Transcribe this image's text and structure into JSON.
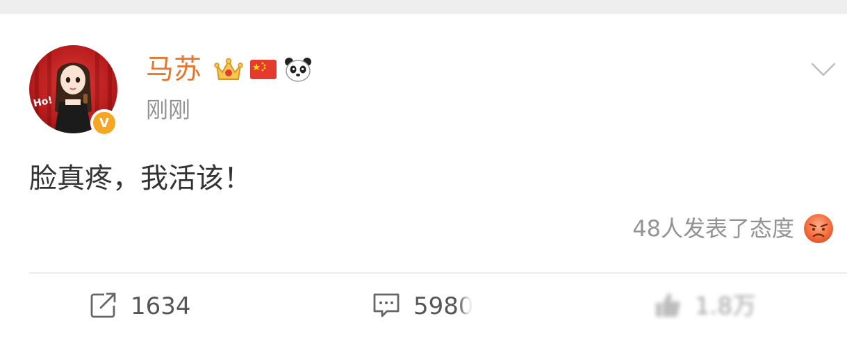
{
  "post": {
    "username": "马苏",
    "timestamp": "刚刚",
    "text": "脸真疼，我活该！",
    "reactions_text": "48人发表了态度",
    "user_badges": [
      "crown-icon",
      "china-flag-icon",
      "panda-icon"
    ],
    "verified_badge": "V",
    "avatar_text": "Ho!",
    "colors": {
      "username": "#e8772e",
      "muted": "#939393",
      "verified": "#f5a623"
    }
  },
  "actions": {
    "repost_count": "1634",
    "comment_count": "5980",
    "like_count": "1.8万"
  }
}
